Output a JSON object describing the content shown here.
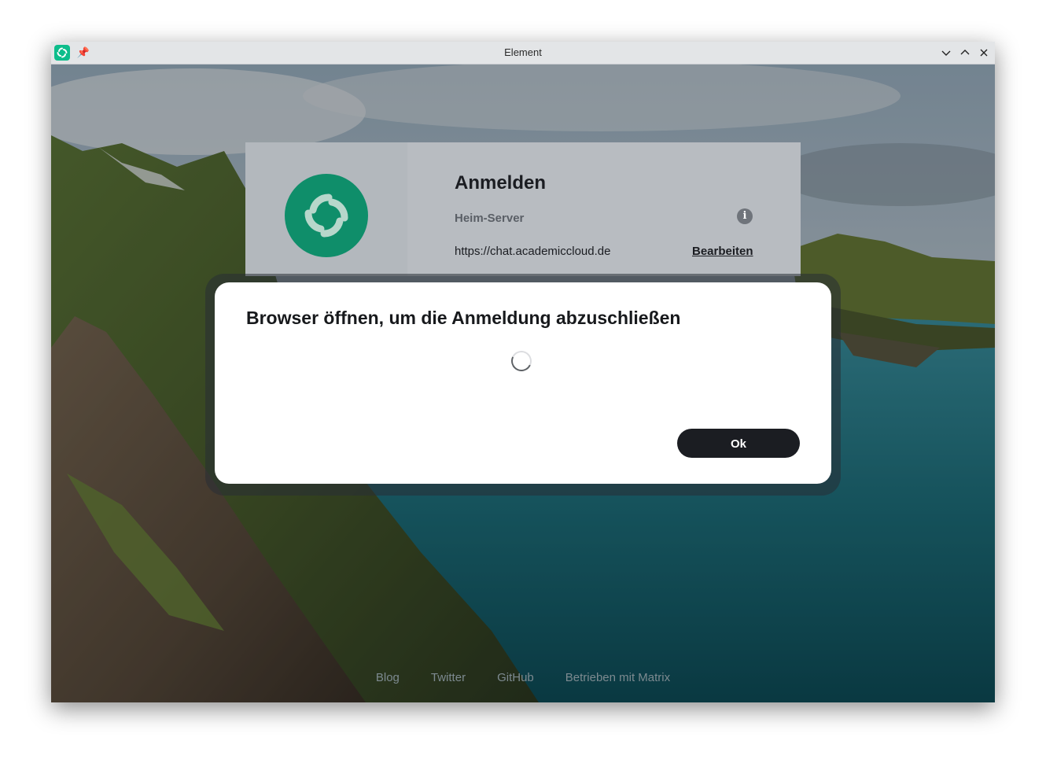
{
  "window": {
    "title": "Element",
    "titlebar_buttons": [
      "chevron-down-icon",
      "chevron-up-icon",
      "close-icon"
    ]
  },
  "auth": {
    "title": "Anmelden",
    "homeserver_label": "Heim-Server",
    "homeserver_url": "https://chat.academiccloud.de",
    "edit_link": "Bearbeiten"
  },
  "dialog": {
    "title": "Browser öffnen, um die Anmeldung abzuschließen",
    "ok_label": "Ok"
  },
  "footer": {
    "links": [
      "Blog",
      "Twitter",
      "GitHub",
      "Betrieben mit Matrix"
    ]
  },
  "colors": {
    "brand_green": "#0dbd8b",
    "logo_green": "#0f8e6a",
    "button_dark": "#1b1d22"
  }
}
